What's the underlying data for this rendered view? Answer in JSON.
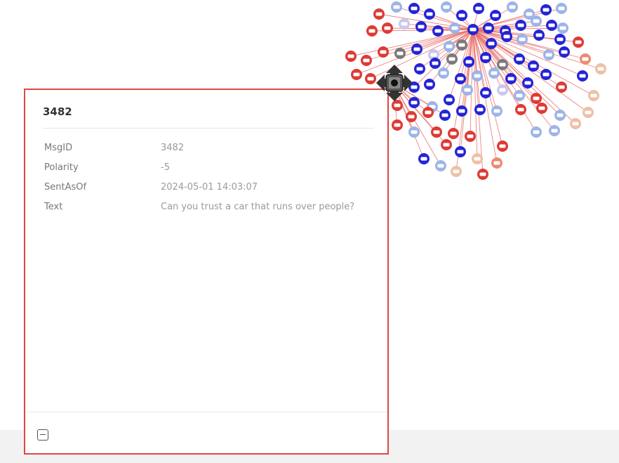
{
  "node_panel": {
    "title": "3482",
    "properties": [
      {
        "key": "MsgID",
        "value": "3482"
      },
      {
        "key": "Polarity",
        "value": "-5"
      },
      {
        "key": "SentAsOf",
        "value": "2024-05-01 14:03:07"
      },
      {
        "key": "Text",
        "value": "Can you trust a car that runs over people?"
      }
    ],
    "collapse_icon": "minus-square-icon"
  },
  "graph": {
    "move_handle_icon": "move-arrows-icon",
    "colors": {
      "edge": "#e8706a",
      "panel_border": "#e0473f",
      "node_red": "#de3a35",
      "node_blue": "#2424d6",
      "node_light_blue": "#9cb4e8",
      "node_lavender": "#c8c8ee",
      "node_peach": "#efbfa6",
      "node_gray": "#7a7a7a",
      "node_salmon": "#ec8b72"
    }
  }
}
